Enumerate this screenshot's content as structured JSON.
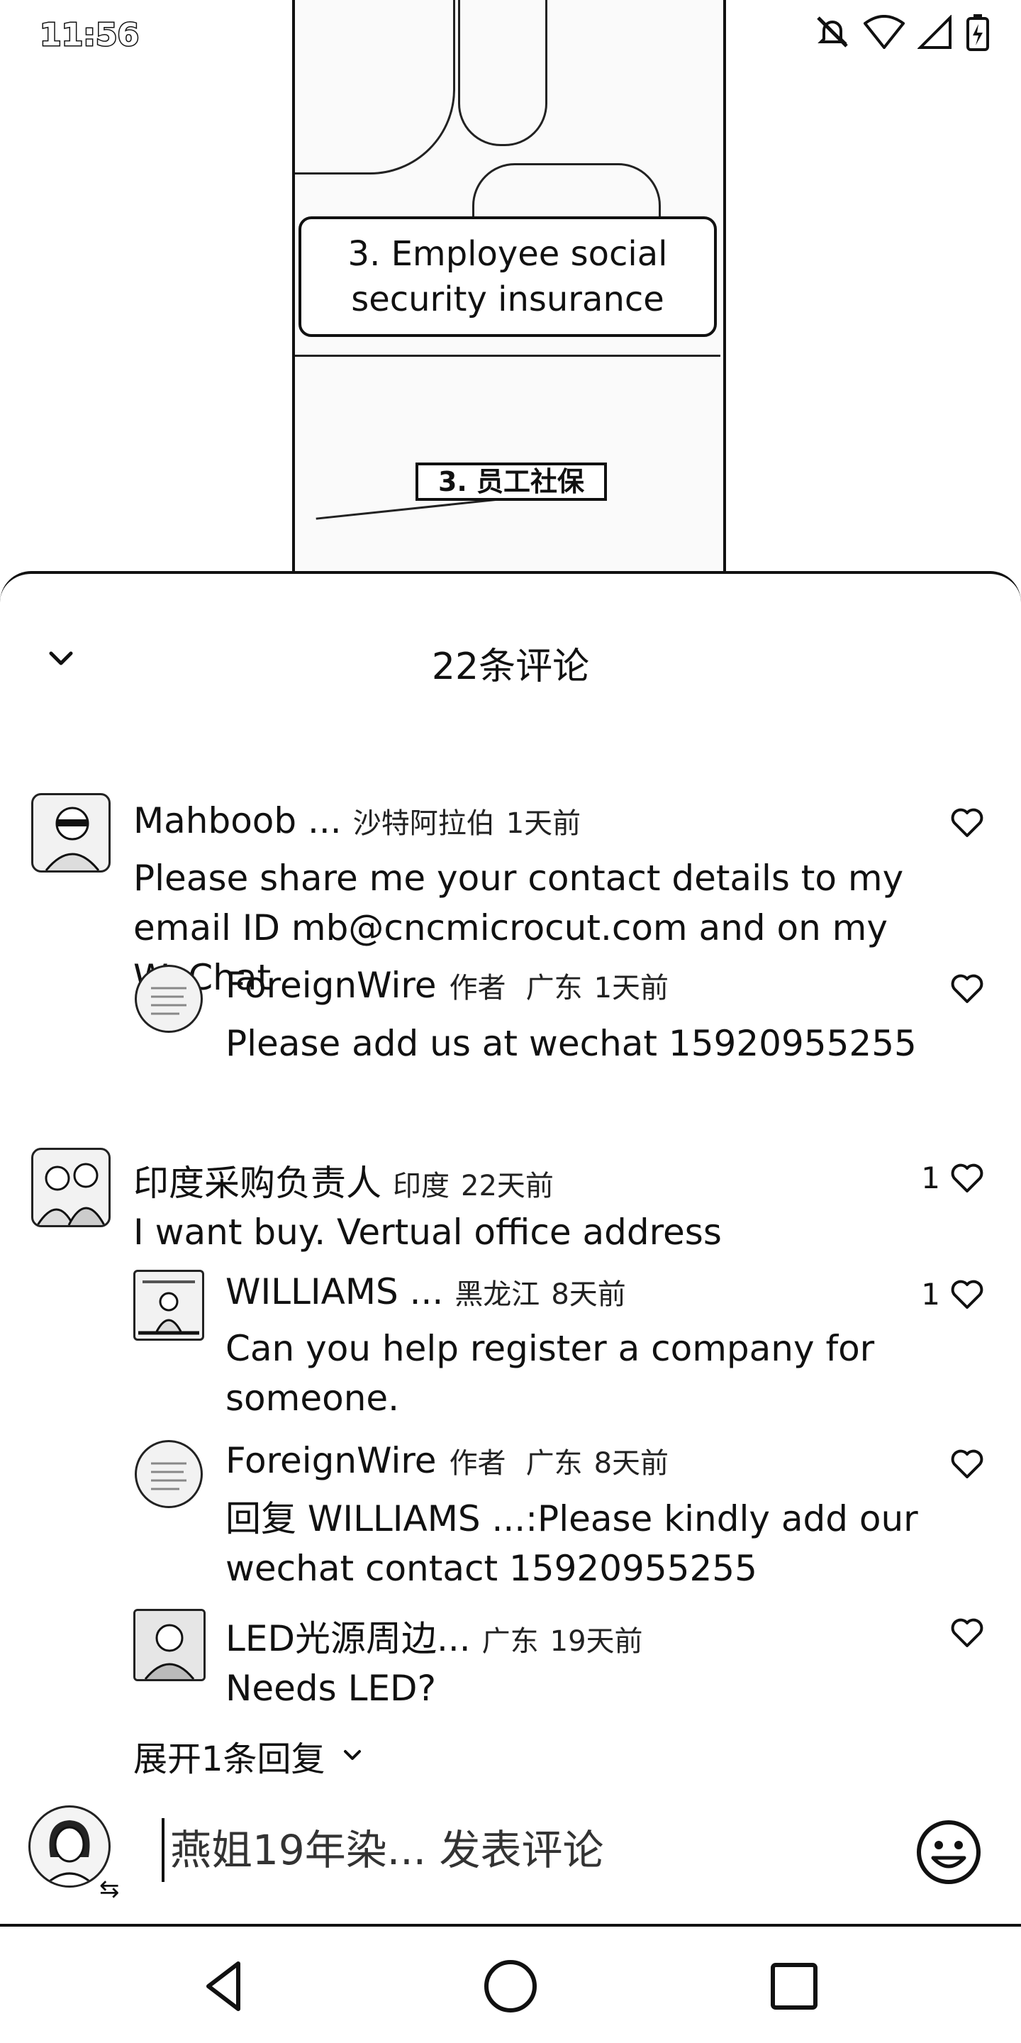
{
  "status_bar": {
    "time": "11:56",
    "icons": [
      "mute-icon",
      "wifi-icon",
      "signal-icon",
      "battery-icon"
    ]
  },
  "video": {
    "caption_en": "3. Employee social security insurance",
    "caption_zh": "3. 员工社保"
  },
  "sheet": {
    "title": "22条评论",
    "collapse_icon": "chevron-down-icon"
  },
  "comments": [
    {
      "name": "Mahboob ...",
      "location": "沙特阿拉伯",
      "time": "1天前",
      "text": "Please share me your contact details to my email ID mb@cncmicrocut.com and on my WeChat",
      "likes": "",
      "replies": [
        {
          "name": "ForeignWire",
          "tag": "作者",
          "location": "广东",
          "time": "1天前",
          "text": "Please add us at wechat 15920955255",
          "likes": ""
        }
      ]
    },
    {
      "name": "印度采购负责人",
      "location": "印度",
      "time": "22天前",
      "text": "I want buy. Vertual office address",
      "likes": "1",
      "replies": [
        {
          "name": "WILLIAMS ...",
          "tag": "",
          "location": "黑龙江",
          "time": "8天前",
          "text": "Can you help register a company for someone.",
          "likes": "1"
        },
        {
          "name": "ForeignWire",
          "tag": "作者",
          "location": "广东",
          "time": "8天前",
          "text": "回复 WILLIAMS ...:Please kindly add our wechat contact 15920955255",
          "likes": ""
        },
        {
          "name": "LED光源周边...",
          "tag": "",
          "location": "广东",
          "time": "19天前",
          "text": "Needs LED?",
          "likes": ""
        }
      ]
    }
  ],
  "expand_label": "展开1条回复",
  "input": {
    "placeholder": "燕姐19年染... 发表评论",
    "emoji_icon": "emoji-icon"
  },
  "nav": [
    "back-icon",
    "home-icon",
    "recents-icon"
  ]
}
